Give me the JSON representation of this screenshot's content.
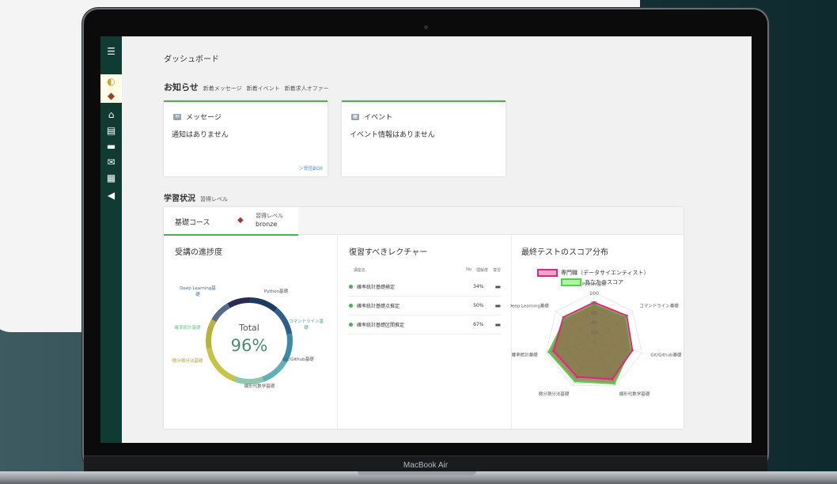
{
  "device": {
    "brand": "MacBook Air"
  },
  "page": {
    "title": "ダッシュボード"
  },
  "notices": {
    "title": "お知らせ",
    "links": [
      "新着メッセージ",
      "新着イベント",
      "新着求人オファー"
    ],
    "cards": [
      {
        "label": "メッセージ",
        "empty_text": "通知はありません",
        "footer_link": "＞受信BOX"
      },
      {
        "label": "イベント",
        "empty_text": "イベント情報はありません"
      }
    ]
  },
  "study": {
    "title": "学習状況",
    "subtitle": "習得レベル",
    "tab": {
      "label": "基礎コース",
      "level_label": "習得レベル",
      "level_value": "bronze"
    }
  },
  "progress": {
    "title": "受講の進捗度",
    "total_label": "Total",
    "total_value": "96%",
    "labels": [
      "Deep Learning基礎",
      "Python基礎",
      "コマンドライン基礎",
      "Git/Github基礎",
      "線形代数学基礎",
      "微分積分法基礎",
      "確率統計基礎"
    ]
  },
  "lectures": {
    "title": "復習すべきレクチャー",
    "columns": [
      "講座名",
      "No",
      "理解度",
      "復習"
    ],
    "rows": [
      {
        "name": "確率統計基礎検定",
        "pct": "34%"
      },
      {
        "name": "確率統計基礎点推定",
        "pct": "50%"
      },
      {
        "name": "確率統計基礎区間推定",
        "pct": "67%"
      }
    ]
  },
  "scores": {
    "title": "最終テストのスコア分布",
    "legend": [
      "専門職（データサイエンティスト）",
      "あなたのスコア"
    ]
  },
  "chart_data": {
    "type": "radar",
    "categories": [
      "Python基礎",
      "コマンドライン基礎",
      "Git/Github基礎",
      "線形代数学基礎",
      "微分積分法基礎",
      "確率統計基礎",
      "Deep Learning基礎"
    ],
    "ticks": [
      "100",
      "80",
      "60",
      "40",
      "20"
    ],
    "range": [
      0,
      100
    ],
    "series": [
      {
        "name": "専門職（データサイエンティスト）",
        "values": [
          80,
          85,
          80,
          85,
          80,
          85,
          80
        ],
        "color": "#e0267d"
      },
      {
        "name": "あなたのスコア",
        "values": [
          75,
          80,
          75,
          95,
          90,
          95,
          75
        ],
        "color": "#49d63e"
      }
    ]
  }
}
